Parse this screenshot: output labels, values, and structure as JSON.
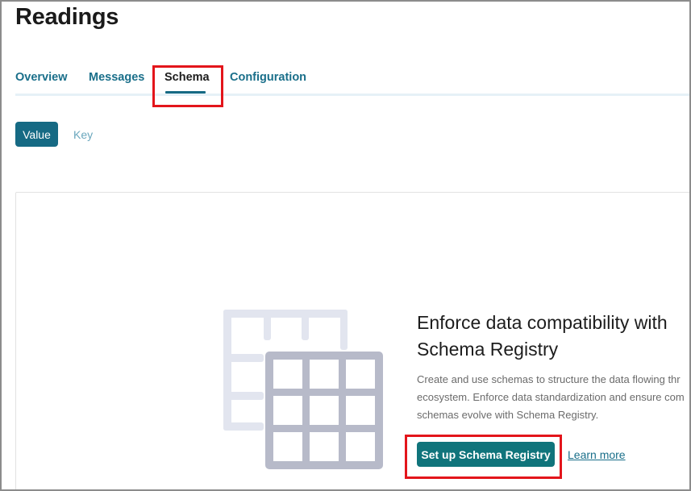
{
  "page": {
    "title": "Readings"
  },
  "tabs": [
    {
      "label": "Overview",
      "active": false
    },
    {
      "label": "Messages",
      "active": false
    },
    {
      "label": "Schema",
      "active": true
    },
    {
      "label": "Configuration",
      "active": false
    }
  ],
  "schema_toggle": {
    "value_label": "Value",
    "key_label": "Key",
    "selected": "Value"
  },
  "empty_state": {
    "illustration": "schema-table-icon",
    "title_line1": "Enforce data compatibility with",
    "title_line2": "Schema Registry",
    "desc_line1": "Create and use schemas to structure the data flowing thr",
    "desc_line2": "ecosystem. Enforce data standardization and ensure com",
    "desc_line3": "schemas evolve with Schema Registry.",
    "primary_button": "Set up Schema Registry",
    "secondary_link": "Learn more"
  },
  "colors": {
    "accent": "#166a84",
    "primary_button": "#10747b",
    "highlight": "#e3151b",
    "illustration_dark": "#b7bac9",
    "illustration_light": "#e2e5ef"
  }
}
